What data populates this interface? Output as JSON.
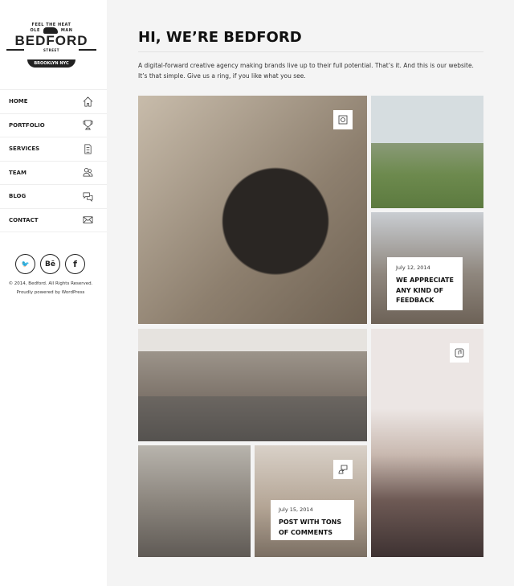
{
  "logo": {
    "top": "FEEL THE HEAT",
    "left": "OLE",
    "right": "MAN",
    "name": "BEDFORD",
    "street": "STREET",
    "band": "BROOKLYN NYC"
  },
  "nav": [
    {
      "label": "HOME",
      "icon": "home-icon"
    },
    {
      "label": "PORTFOLIO",
      "icon": "trophy-icon"
    },
    {
      "label": "SERVICES",
      "icon": "document-icon"
    },
    {
      "label": "TEAM",
      "icon": "users-icon"
    },
    {
      "label": "BLOG",
      "icon": "chat-icon"
    },
    {
      "label": "CONTACT",
      "icon": "envelope-icon"
    }
  ],
  "social": {
    "twitter": "🐦",
    "behance": "Bē",
    "facebook": "f"
  },
  "footer": {
    "copyright": "© 2014, Bedford. All Rights Reserved.",
    "powered": "Proudly powered by WordPress"
  },
  "header": {
    "title": "HI, WE’RE BEDFORD",
    "intro": "A digital-forward creative agency making brands live up to their full potential. That’s it. And this is our website. It’s that simple. Give us a ring, if you like what you see."
  },
  "posts": [
    {
      "date": "July 12, 2014",
      "title": "WE APPRECIATE ANY KIND OF FEEDBACK"
    },
    {
      "date": "July 15, 2014",
      "title": "POST WITH TONS OF COMMENTS"
    }
  ]
}
